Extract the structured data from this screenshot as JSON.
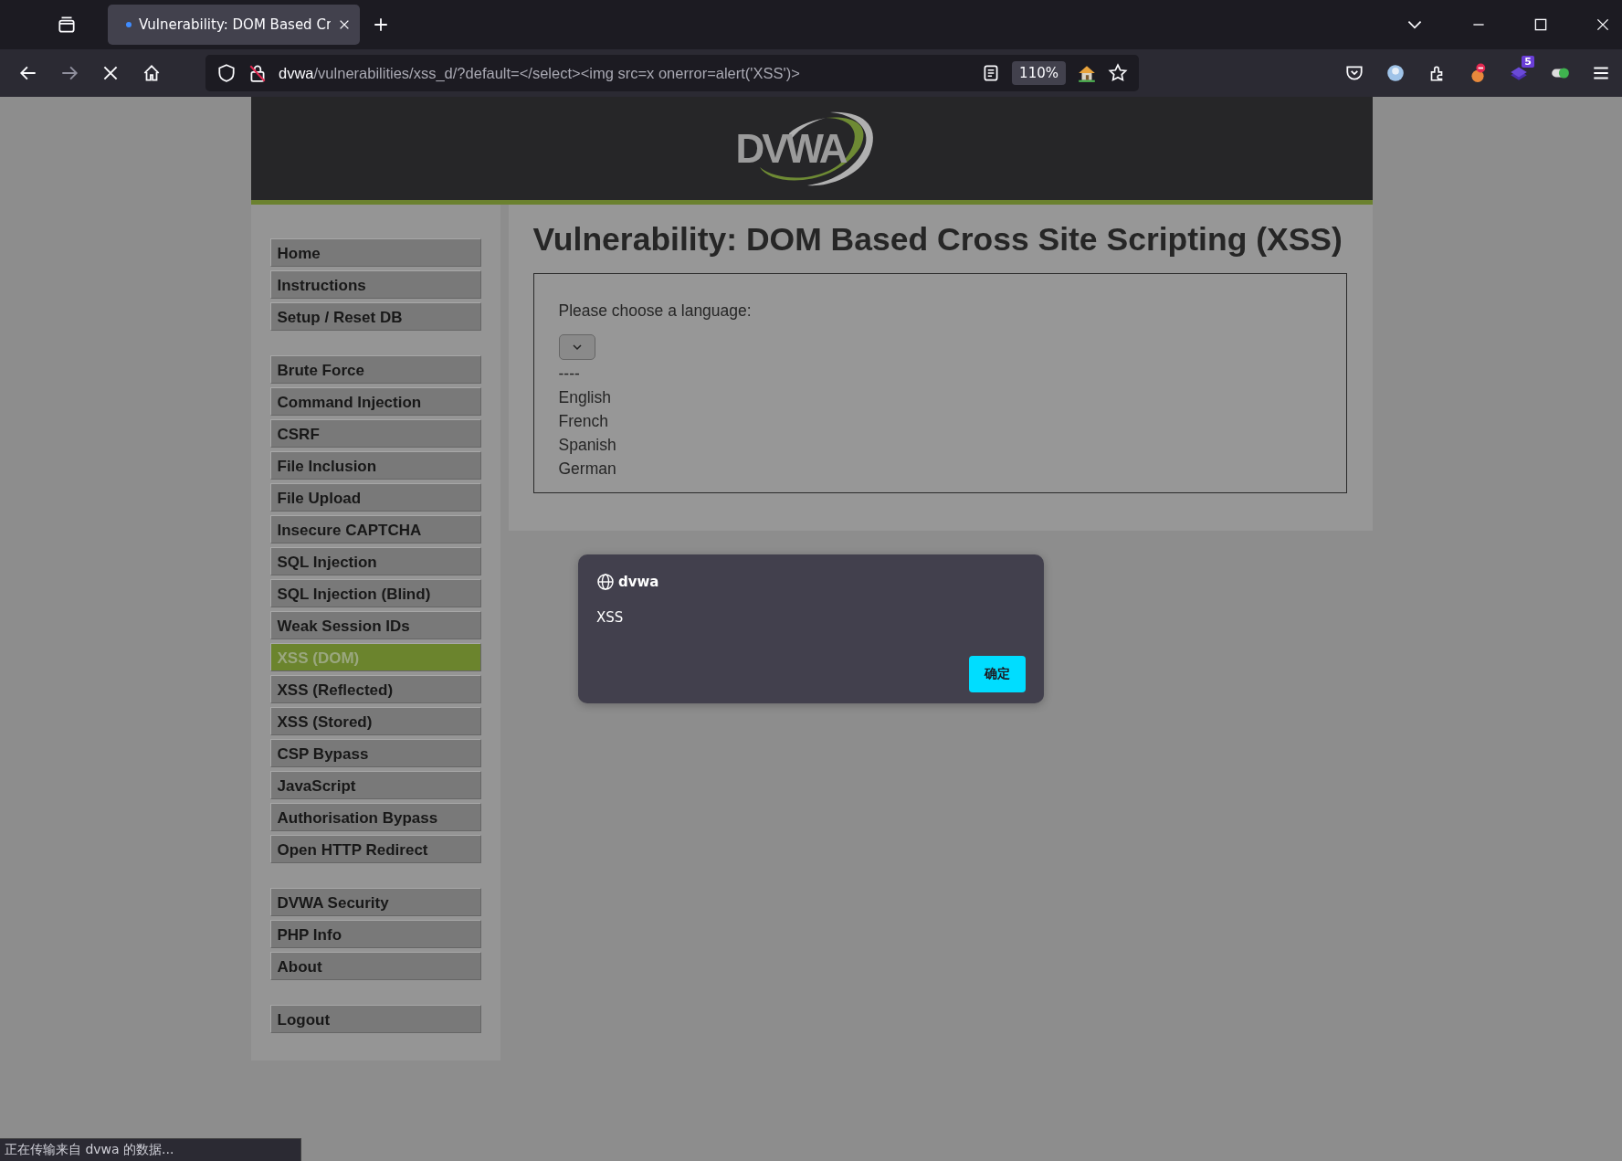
{
  "browser": {
    "tab": {
      "title": "Vulnerability: DOM Based Cr",
      "selected": true
    },
    "url_host": "dvwa",
    "url_path": "/vulnerabilities/xss_d/?default=</select><img src=x onerror=alert('XSS')>",
    "zoom": "110%",
    "extension_badge": "5"
  },
  "header": {
    "logo": "DVWA"
  },
  "menu": [
    [
      {
        "label": "Home",
        "selected": false
      },
      {
        "label": "Instructions",
        "selected": false
      },
      {
        "label": "Setup / Reset DB",
        "selected": false
      }
    ],
    [
      {
        "label": "Brute Force",
        "selected": false
      },
      {
        "label": "Command Injection",
        "selected": false
      },
      {
        "label": "CSRF",
        "selected": false
      },
      {
        "label": "File Inclusion",
        "selected": false
      },
      {
        "label": "File Upload",
        "selected": false
      },
      {
        "label": "Insecure CAPTCHA",
        "selected": false
      },
      {
        "label": "SQL Injection",
        "selected": false
      },
      {
        "label": "SQL Injection (Blind)",
        "selected": false
      },
      {
        "label": "Weak Session IDs",
        "selected": false
      },
      {
        "label": "XSS (DOM)",
        "selected": true
      },
      {
        "label": "XSS (Reflected)",
        "selected": false
      },
      {
        "label": "XSS (Stored)",
        "selected": false
      },
      {
        "label": "CSP Bypass",
        "selected": false
      },
      {
        "label": "JavaScript",
        "selected": false
      },
      {
        "label": "Authorisation Bypass",
        "selected": false
      },
      {
        "label": "Open HTTP Redirect",
        "selected": false
      }
    ],
    [
      {
        "label": "DVWA Security",
        "selected": false
      },
      {
        "label": "PHP Info",
        "selected": false
      },
      {
        "label": "About",
        "selected": false
      }
    ],
    [
      {
        "label": "Logout",
        "selected": false
      }
    ]
  ],
  "main": {
    "title": "Vulnerability: DOM Based Cross Site Scripting (XSS)",
    "prompt": "Please choose a language:",
    "options": [
      "----",
      "English",
      "French",
      "Spanish",
      "German"
    ]
  },
  "alert": {
    "origin": "dvwa",
    "message": "XSS",
    "ok": "确定"
  },
  "status_bar": "正在传输来自 dvwa 的数据..."
}
